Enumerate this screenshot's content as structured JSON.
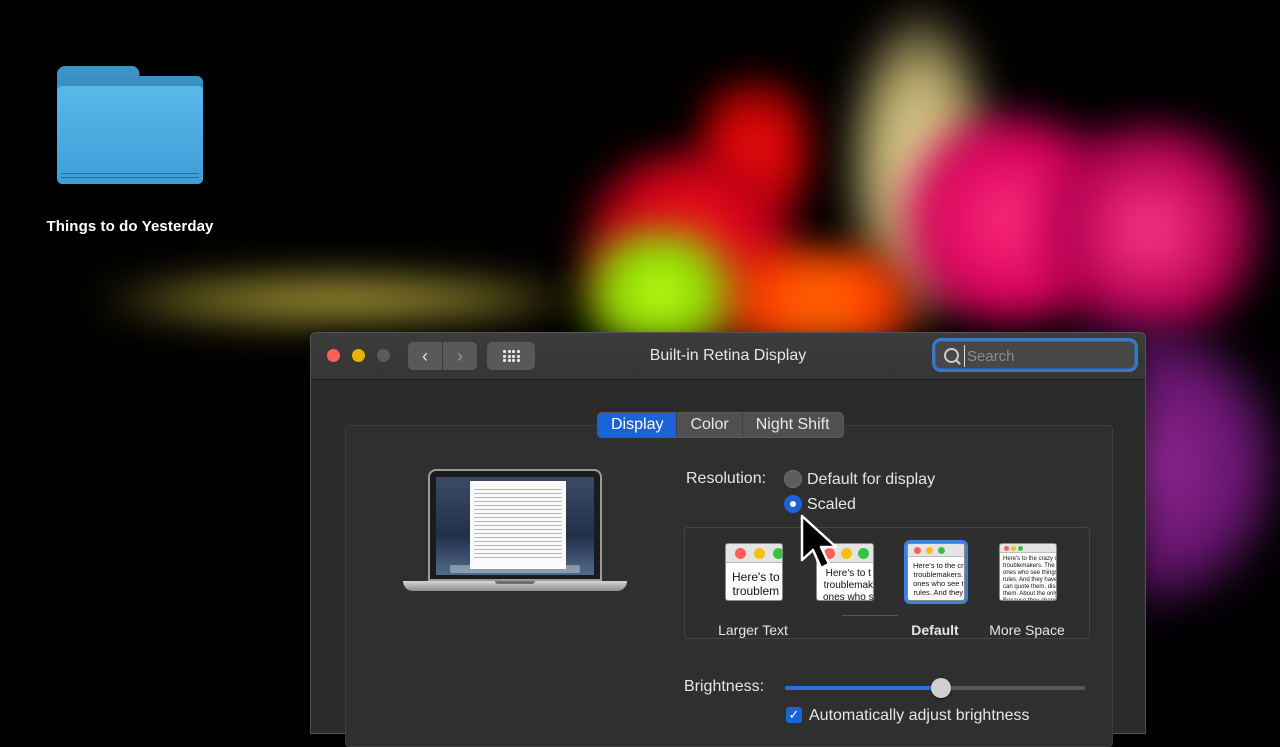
{
  "desktop": {
    "folder_label": "Things to do Yesterday"
  },
  "window": {
    "title": "Built-in Retina Display",
    "search_placeholder": "Search",
    "tabs": [
      {
        "label": "Display",
        "active": true
      },
      {
        "label": "Color",
        "active": false
      },
      {
        "label": "Night Shift",
        "active": false
      }
    ],
    "resolution": {
      "label": "Resolution:",
      "options": [
        {
          "label": "Default for display",
          "selected": false
        },
        {
          "label": "Scaled",
          "selected": true
        }
      ]
    },
    "scale_options": [
      {
        "label": "Larger Text",
        "preview": "Here's to\ntroublem",
        "selected": false
      },
      {
        "label": "",
        "preview": "Here's to t\ntroublemak\nones who s",
        "selected": false
      },
      {
        "label": "Default",
        "preview": "Here's to the cr\ntroublemakers.\nones who see t\nrules. And they",
        "selected": true
      },
      {
        "label": "More Space",
        "preview": "Here's to the crazy ones\ntroublemakers. The rou\nones who see things dif\nrules. And they have no\ncan quote them, disagr\nthem. About the only th\nBecause they change",
        "selected": false
      }
    ],
    "brightness": {
      "label": "Brightness:",
      "level": 0.52
    },
    "auto_brightness": {
      "label": "Automatically adjust brightness",
      "checked": true
    }
  },
  "colors": {
    "accent": "#1d63d8",
    "window_bg": "#2b2b2b",
    "close": "#ff5f57",
    "minimize": "#e6b400"
  }
}
